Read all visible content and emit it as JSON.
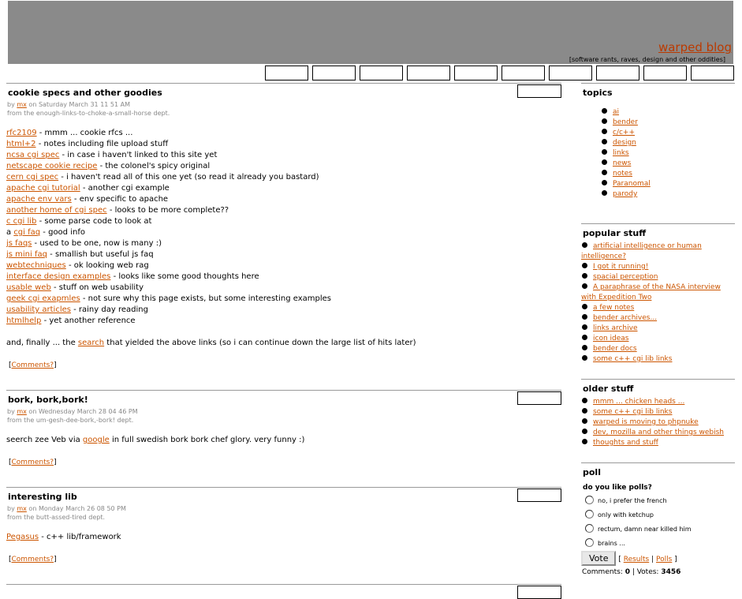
{
  "header": {
    "site_title": "warped blog",
    "tagline": "[software rants, raves, design and other oddities]",
    "nav_box_count": 10
  },
  "posts": [
    {
      "title": "cookie specs and other goodies",
      "meta_by": "by ",
      "author": "mx",
      "meta_on": " on Saturday March 31 11 51 AM",
      "dept": "from the enough-links-to-choke-a-small-horse dept.",
      "lines": [
        {
          "pre": "",
          "link": "rfc2109",
          "post": " - mmm ... cookie rfcs ..."
        },
        {
          "pre": "",
          "link": "html+2",
          "post": " - notes including file upload stuff"
        },
        {
          "pre": "",
          "link": "ncsa cgi spec",
          "post": " - in case i haven't linked to this site yet"
        },
        {
          "pre": "",
          "link": "netscape cookie recipe",
          "post": " - the colonel's spicy original"
        },
        {
          "pre": "",
          "link": "cern cgi spec",
          "post": " - i haven't read all of this one yet (so read it already you bastard)"
        },
        {
          "pre": "",
          "link": "apache cgi tutorial",
          "post": " - another cgi example"
        },
        {
          "pre": "",
          "link": "apache env vars",
          "post": " - env specific to apache"
        },
        {
          "pre": "",
          "link": "another home of cgi spec",
          "post": " - looks to be more complete??"
        },
        {
          "pre": "",
          "link": "c cgi lib",
          "post": " - some parse code to look at"
        },
        {
          "pre": "a ",
          "link": "cgi faq",
          "post": " - good info"
        },
        {
          "pre": "",
          "link": "js faqs",
          "post": " - used to be one, now is many :)"
        },
        {
          "pre": "",
          "link": "js mini faq",
          "post": " - smallish but useful js faq"
        },
        {
          "pre": "",
          "link": "webtechniques",
          "post": " - ok looking web rag"
        },
        {
          "pre": "",
          "link": "interface design examples",
          "post": " - looks like some good thoughts here"
        },
        {
          "pre": "",
          "link": "usable web",
          "post": " - stuff on web usability"
        },
        {
          "pre": "",
          "link": "geek cgi exapmles",
          "post": " - not sure why this page exists, but some interesting examples"
        },
        {
          "pre": "",
          "link": "usability articles",
          "post": " - rainy day reading"
        },
        {
          "pre": "",
          "link": "htmlhelp",
          "post": " - yet another reference"
        },
        {
          "pre": "",
          "link": "",
          "post": ""
        },
        {
          "pre": "and, finally ... the ",
          "link": "search",
          "post": " that yielded the above links (so i can continue down the large list of hits later)"
        }
      ],
      "comments": "Comments?"
    },
    {
      "title": "bork, bork,bork!",
      "meta_by": "by ",
      "author": "mx",
      "meta_on": " on Wednesday March 28 04 46 PM",
      "dept": "from the um-gesh-dee-bork,-bork! dept.",
      "lines": [
        {
          "pre": "seerch zee Veb via ",
          "link": "google",
          "post": " in full swedish bork bork chef glory. very funny :)"
        }
      ],
      "comments": "Comments?"
    },
    {
      "title": "interesting lib",
      "meta_by": "by ",
      "author": "mx",
      "meta_on": " on Monday March 26 08 50 PM",
      "dept": "from the butt-assed-tired dept.",
      "lines": [
        {
          "pre": "",
          "link": "Pegasus",
          "post": " - c++ lib/framework"
        }
      ],
      "comments": "Comments?"
    }
  ],
  "sidebar": {
    "topics": {
      "title": "topics",
      "items": [
        "ai",
        "bender",
        "c/c++",
        "design",
        "links",
        "news",
        "notes",
        "Paranomal",
        "parody"
      ]
    },
    "popular": {
      "title": "popular stuff",
      "items": [
        "artificial intelligence or human intelligence?",
        "I got it running!",
        "spacial perception",
        "A paraphrase of the NASA interview with Expedition Two",
        "a few notes",
        "bender archives...",
        "links archive",
        "icon ideas",
        "bender docs",
        "some c++ cgi lib links"
      ]
    },
    "older": {
      "title": "older stuff",
      "items": [
        "mmm ... chicken heads ...",
        "some c++ cgi lib links",
        "warped is moving to phpnuke",
        "dev, mozilla and other things webish",
        "thoughts and stuff"
      ]
    },
    "poll": {
      "title": "poll",
      "question": "do you like polls?",
      "options": [
        "no, i prefer the french",
        "only with ketchup",
        "rectum, damn near killed him",
        "brains ..."
      ],
      "vote_label": "Vote",
      "results_label": "Results",
      "polls_label": "Polls",
      "comments_label": "Comments: ",
      "comments_count": "0",
      "votes_label": " | Votes: ",
      "votes_count": "3456"
    }
  }
}
